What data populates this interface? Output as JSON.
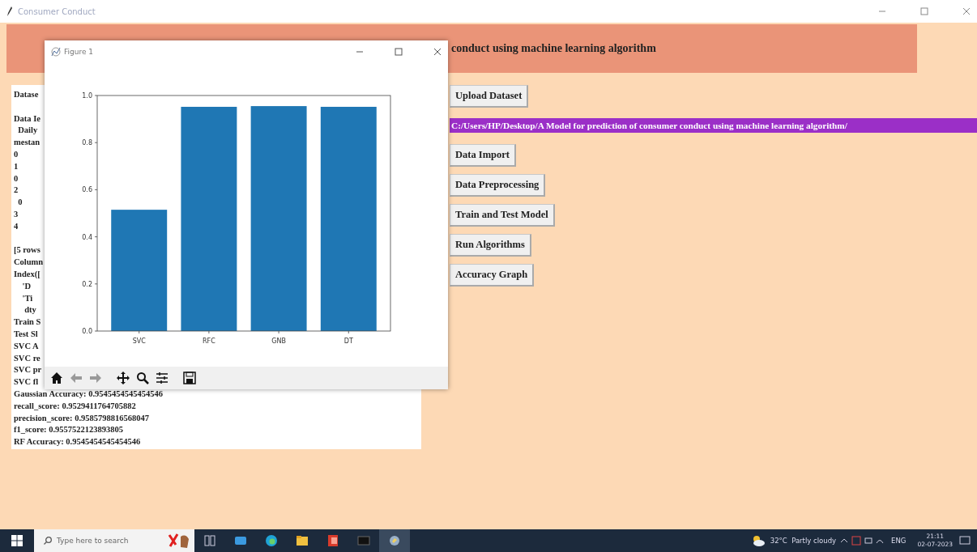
{
  "window": {
    "title": "Consumer Conduct"
  },
  "header": {
    "title": "conduct using machine learning algorithm"
  },
  "output_blocks": [
    [
      "Datase"
    ],
    [
      "Data Ie",
      "  Daily",
      "mestan",
      "0",
      "1",
      "0",
      "2",
      "  0",
      "3",
      "4"
    ],
    [
      "[5 rows",
      "Column",
      "Index([",
      "    'D",
      "    'Ti",
      "     dty",
      "Train S",
      "Test Sl",
      "SVC A",
      "SVC re",
      "SVC pr",
      "SVC fl",
      "Gaussian Accuracy: 0.9545454545454546",
      "recall_score: 0.9529411764705882",
      "precision_score: 0.9585798816568047",
      "f1_score: 0.9557522123893805",
      "RF Accuracy: 0.9545454545454546"
    ]
  ],
  "controls": [
    {
      "kind": "button",
      "label": "Upload Dataset"
    },
    {
      "kind": "path",
      "text": "C:/Users/HP/Desktop/A Model for prediction of consumer conduct using machine learning algorithm/"
    },
    {
      "kind": "button",
      "label": "Data Import"
    },
    {
      "kind": "button",
      "label": "Data Preprocessing"
    },
    {
      "kind": "button",
      "label": "Train and Test Model"
    },
    {
      "kind": "button",
      "label": "Run Algorithms"
    },
    {
      "kind": "button",
      "label": "Accuracy Graph"
    }
  ],
  "figure_window": {
    "title": "Figure 1",
    "chart_data": {
      "type": "bar",
      "categories": [
        "SVC",
        "RFC",
        "GNB",
        "DT"
      ],
      "series": [
        {
          "color": "#1f77b4",
          "values": [
            0.515,
            0.952,
            0.955,
            0.952
          ]
        }
      ],
      "ylim": [
        0,
        1
      ],
      "yticks": [
        {
          "value": 0,
          "label": "0.0"
        },
        {
          "value": 0.2,
          "label": "0.2"
        },
        {
          "value": 0.4,
          "label": "0.4"
        },
        {
          "value": 0.6,
          "label": "0.6"
        },
        {
          "value": 0.8,
          "label": "0.8"
        },
        {
          "value": 1,
          "label": "1.0"
        }
      ]
    }
  },
  "taskbar": {
    "search_placeholder": "Type here to search",
    "weather": "32°C  Partly cloudy",
    "language": "ENG",
    "time": "21:11",
    "date": "02-07-2023"
  }
}
